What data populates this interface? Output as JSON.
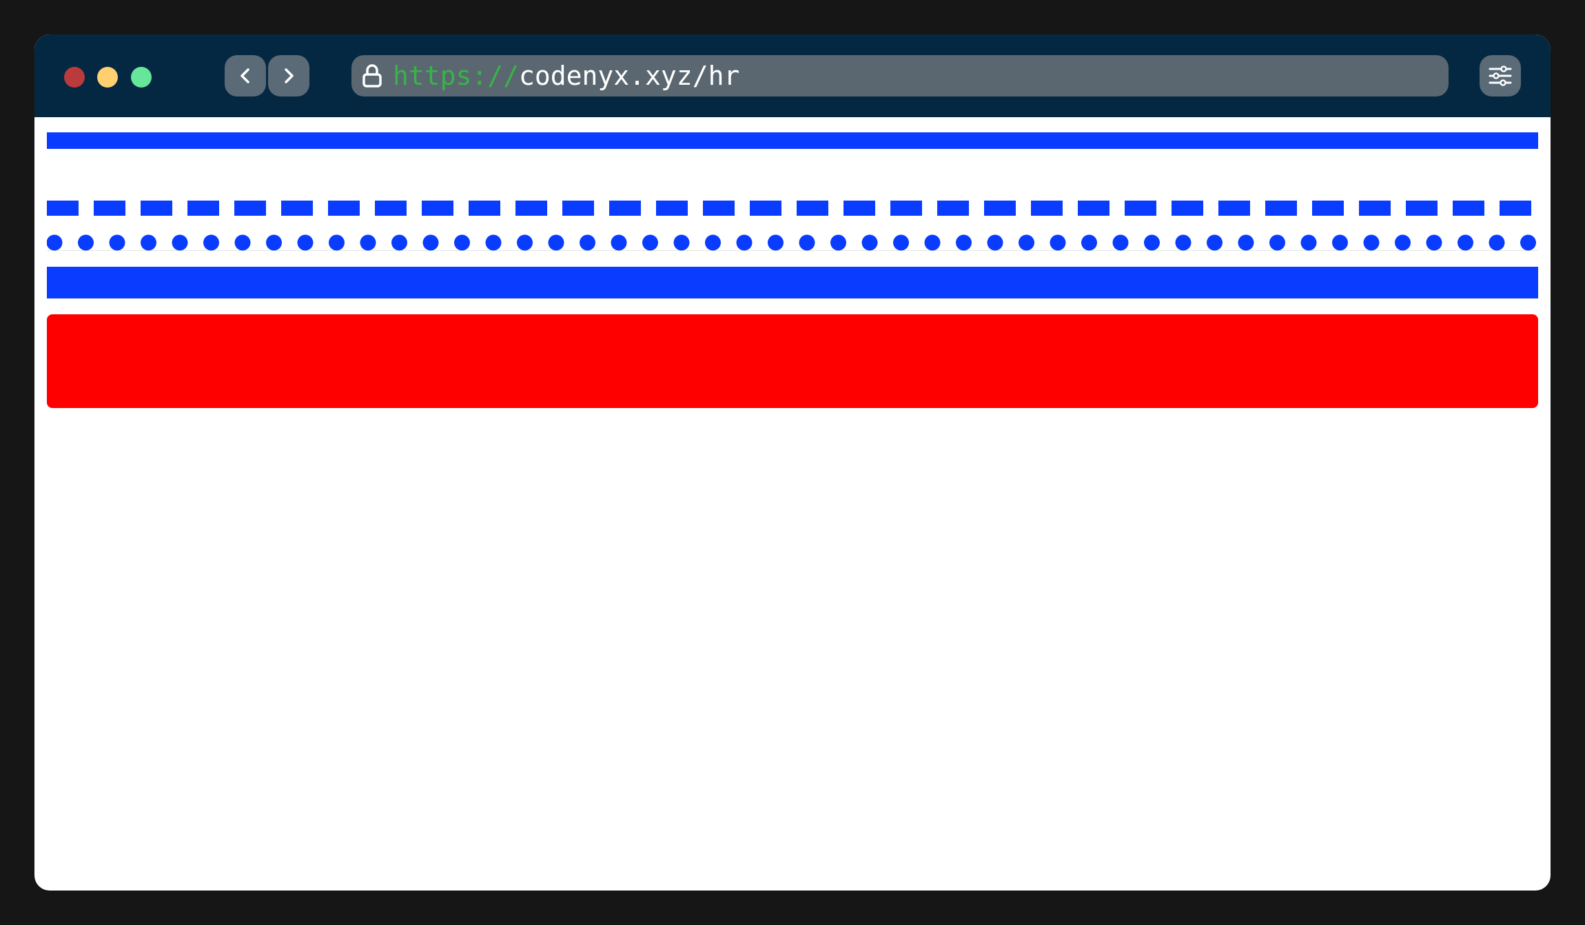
{
  "browser": {
    "url_scheme": "https://",
    "url_rest": "codenyx.xyz/hr",
    "accent_colors": {
      "titlebar": "#052842",
      "rule_blue": "#0a3cff",
      "rule_red": "#ff0000",
      "scheme_green": "#39b24a"
    },
    "icons": {
      "back": "chevron-left-icon",
      "forward": "chevron-right-icon",
      "lock": "lock-icon",
      "settings": "sliders-icon"
    }
  },
  "page": {
    "rules": [
      "solid",
      "dashed",
      "dotted",
      "thick-solid",
      "red-rounded"
    ]
  }
}
